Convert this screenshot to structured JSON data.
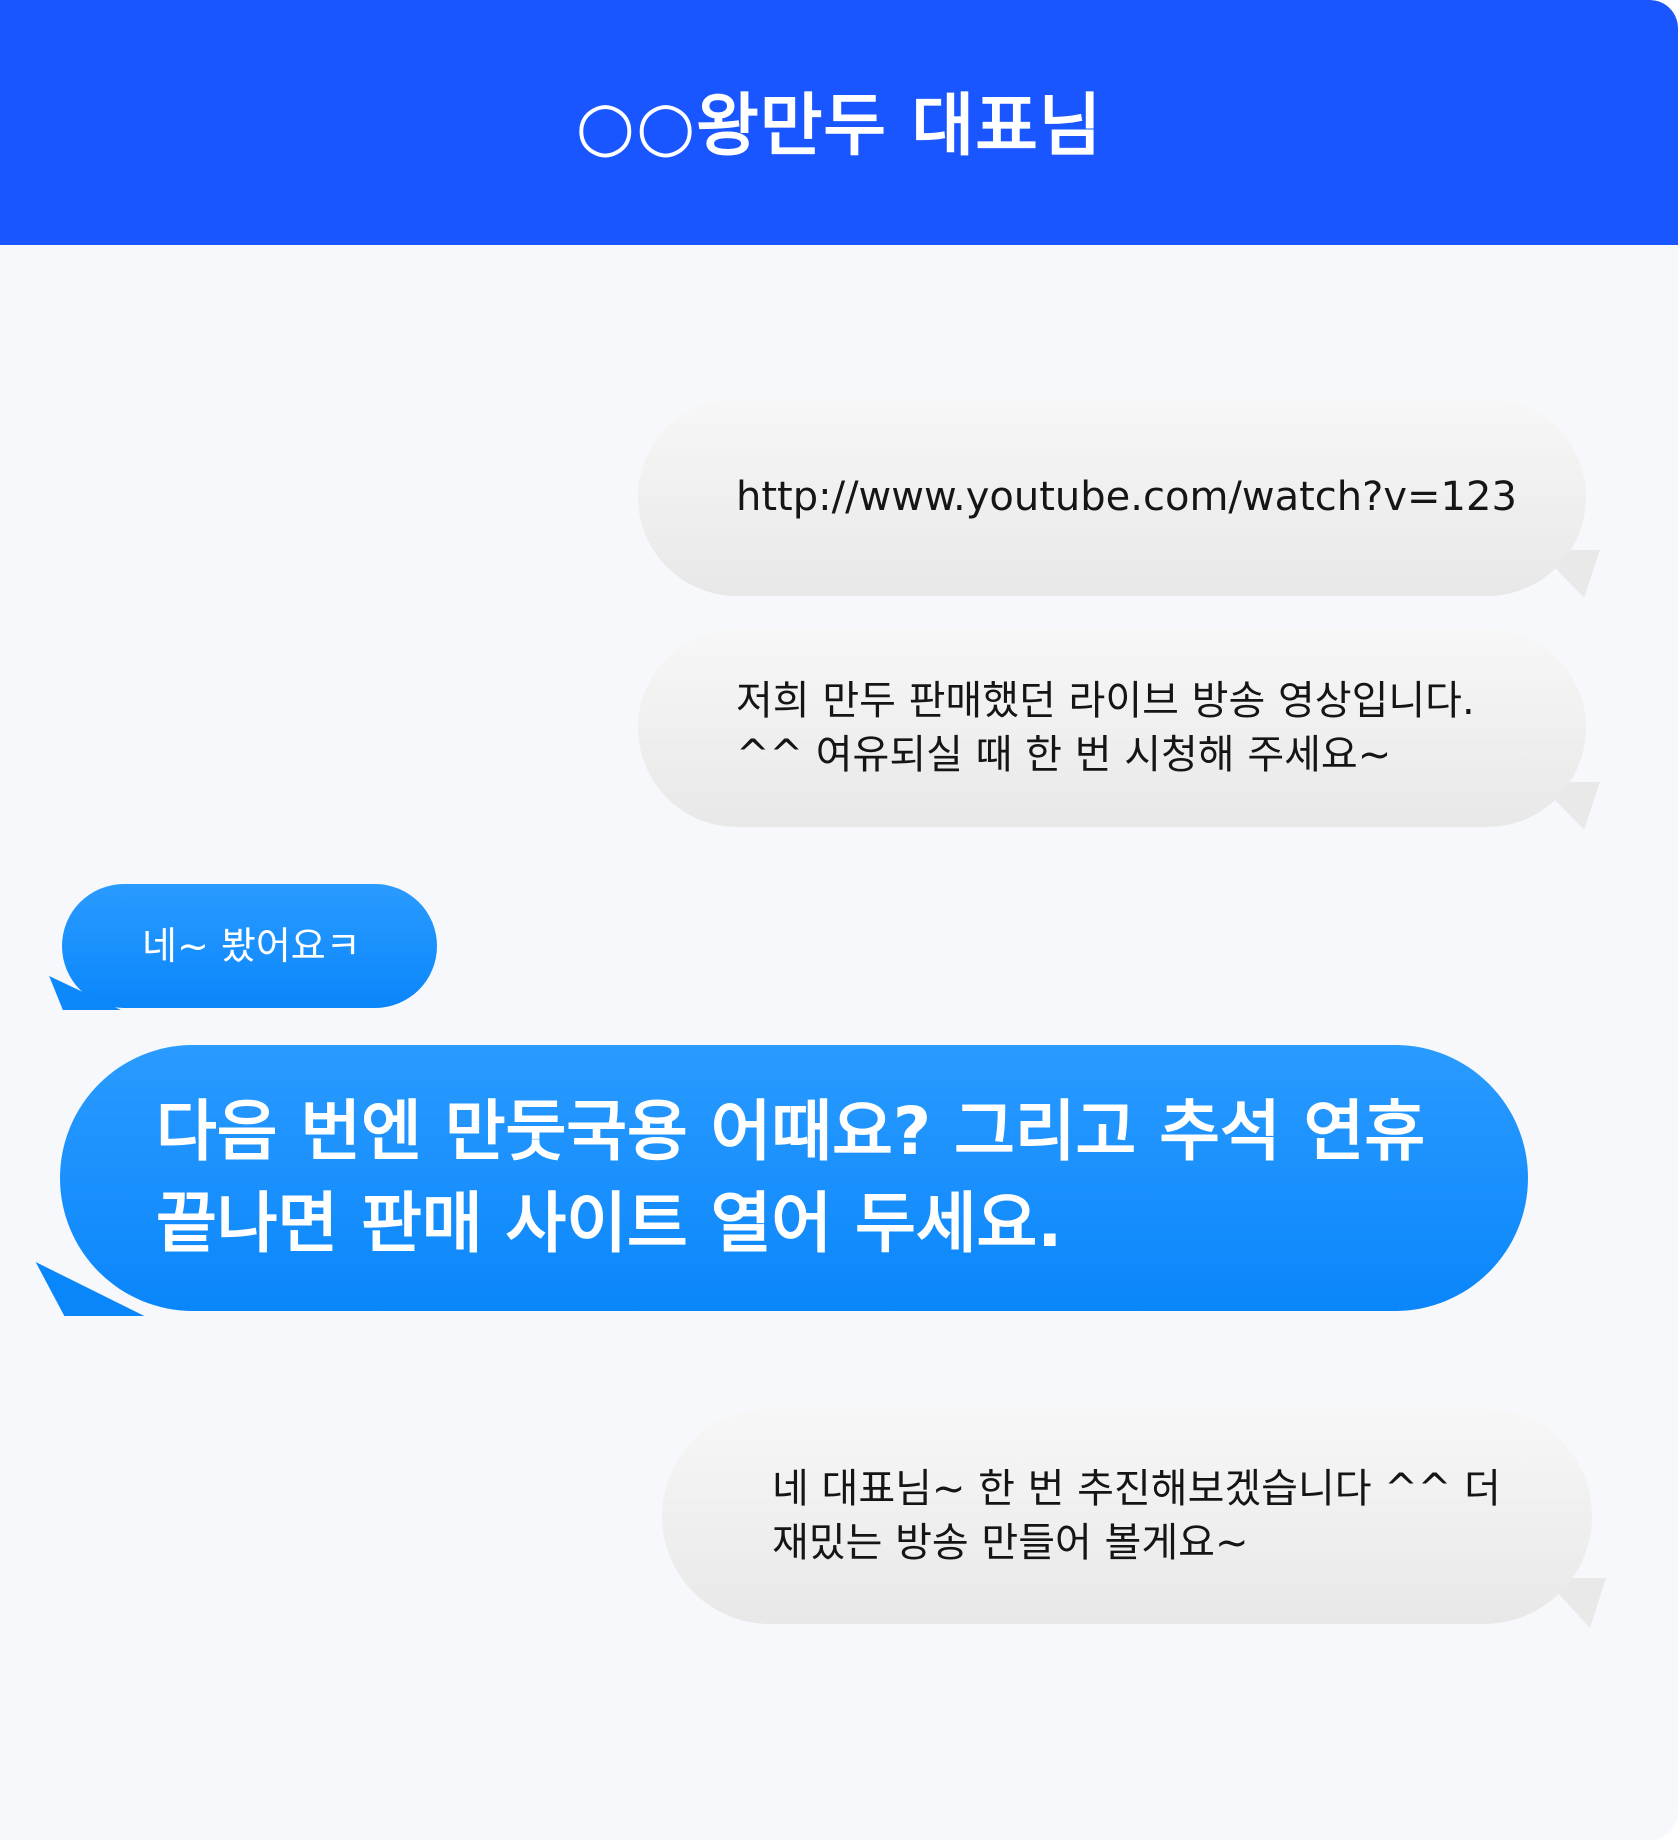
{
  "header": {
    "title": "○○왕만두 대표님"
  },
  "messages": [
    {
      "sender": "me",
      "text": "http://www.youtube.com/watch?v=123"
    },
    {
      "sender": "me",
      "text": "저희 만두 판매했던 라이브 방송 영상입니다.\n^^ 여유되실 때 한 번 시청해 주세요~"
    },
    {
      "sender": "other",
      "text": "네~ 봤어요ㅋ"
    },
    {
      "sender": "other",
      "text": "다음 번엔 만둣국용 어때요? 그리고 추석 연휴\n끝나면 판매 사이트 열어 두세요."
    },
    {
      "sender": "me",
      "text": "네 대표님~ 한 번 추진해보겠습니다 ^^ 더\n재밌는 방송 만들어 볼게요~"
    }
  ],
  "colors": {
    "header_bg": "#1a56ff",
    "chat_bg": "#f6f8fb",
    "bubble_gray": "#ececec",
    "bubble_blue": "#1790fc"
  }
}
